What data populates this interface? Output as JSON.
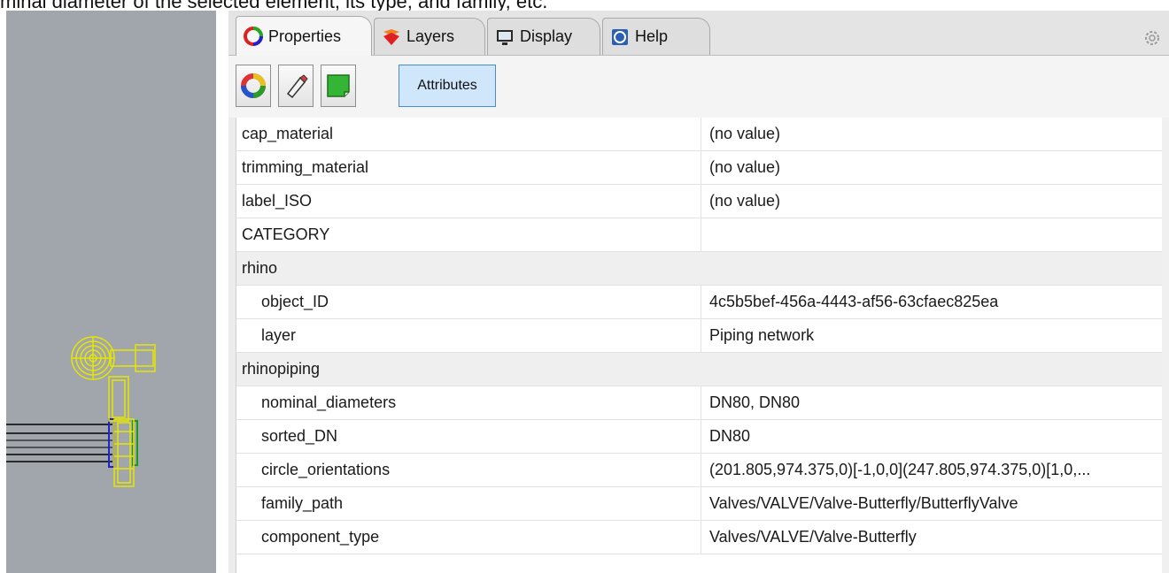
{
  "caption": "minal diameter of the selected element, its type, and family, etc.",
  "tabs": [
    {
      "label": "Properties",
      "icon": "properties-icon"
    },
    {
      "label": "Layers",
      "icon": "layers-icon"
    },
    {
      "label": "Display",
      "icon": "display-icon"
    },
    {
      "label": "Help",
      "icon": "help-icon"
    }
  ],
  "toolbar": {
    "attributes_label": "Attributes"
  },
  "attributes": [
    {
      "name": "cap_material",
      "value": "(no value)"
    },
    {
      "name": "trimming_material",
      "value": "(no value)"
    },
    {
      "name": "label_ISO",
      "value": "(no value)"
    },
    {
      "name": "CATEGORY",
      "value": ""
    },
    {
      "group": "rhino"
    },
    {
      "name": "object_ID",
      "value": "4c5b5bef-456a-4443-af56-63cfaec825ea"
    },
    {
      "name": "layer",
      "value": "Piping network"
    },
    {
      "group": "rhinopiping"
    },
    {
      "name": "nominal_diameters",
      "value": "DN80, DN80"
    },
    {
      "name": "sorted_DN",
      "value": "DN80"
    },
    {
      "name": "circle_orientations",
      "value": "(201.805,974.375,0)[-1,0,0](247.805,974.375,0)[1,0,..."
    },
    {
      "name": "family_path",
      "value": "Valves/VALVE/Valve-Butterfly/ButterflyValve"
    },
    {
      "name": "component_type",
      "value": "Valves/VALVE/Valve-Butterfly"
    }
  ],
  "colors": {
    "viewport_bg": "#a1a6ad",
    "selection": "#e6e600",
    "active_button": "#cfe6fb"
  }
}
